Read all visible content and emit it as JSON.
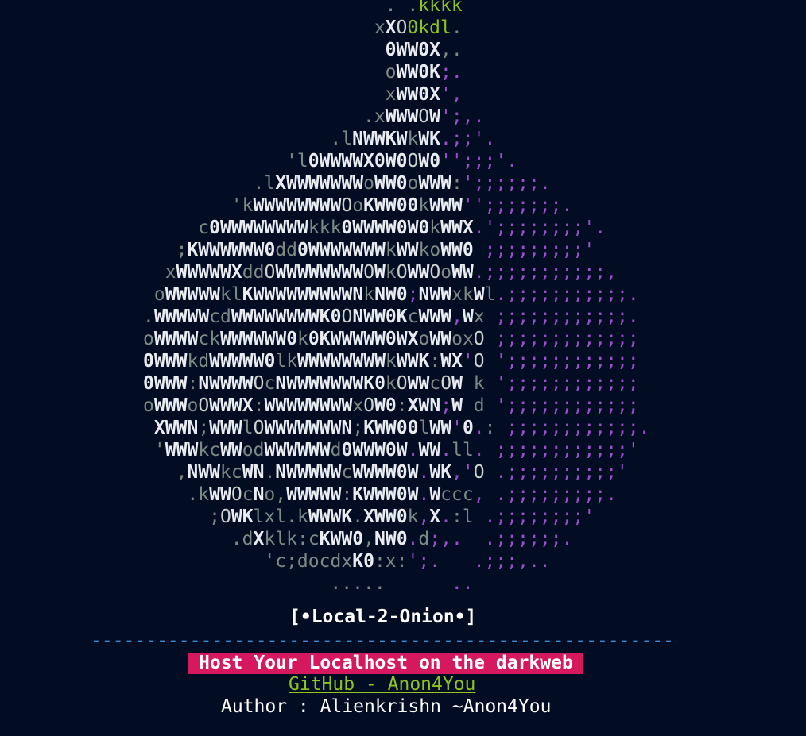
{
  "theme": {
    "background": "#020d24",
    "accent_green": "#8fc31f",
    "accent_purple": "#9b4fcf",
    "tagline_bg": "#d6195e",
    "divider_color": "#3c8fd6"
  },
  "ascii_art": [
    "                                   . .kkkk",
    "                                  xXO0kdl.",
    "                                   0WW0X,.",
    "                                   oWW0K;.",
    "                                   xWW0X',",
    "                                 .xWWWOW';,.",
    "                              .lNWWKWkWK.;;'.",
    "                          'l0WWWWX0W0OW0'';;;'.",
    "                       .lXWWWWWWWoWW0oWWW:';;;;;;.",
    "                     'kWWWWWWWWOoKWW00kWWW'';;;;;;;.",
    "                  c0WWWWWWWWkkk0WWWW0W0kWWX.';;;;;;;;'.",
    "                ;KWWWWWW0dd0WWWWWWWkWWkoWW0 ;;;;;;;;;'",
    "               xWWWWWXddOWWWWWWWWOWkOWWOoWW.;;;;;;;;;;;,",
    "              oWWWWWklKWWWWWWWWWNkNW0;NWWxkWl.;;;;;;;;;;;.",
    "             .WWWWWcdWWWWWWWWK0ONWW0KcWWW,Wx ;;;;;;;;;;;;.",
    "             oWWWWckWWWWWW0k0KWWWWW0WXoWWoxO ;;;;;;;;;;;;;",
    "             0WWWkdWWWWW0lkWWWWWWWWkWWK:WX'O ';;;;;;;;;;;;",
    "             0WWW:NWWWWOcNWWWWWWWK0kOWWcOW k ';;;;;;;;;;;;",
    "             oWWWoOWWWX:WWWWWWWWxOW0:XWN;W d ';;;;;;;;;;;;",
    "              XWWN;WWWlOWWWWWWWN;KWW00lWW'0.: ;;;;;;;;;;;;.",
    "              'WWWkcWWodWWWWWWd0WWW0W.WW.ll. ;;;;;;;;;;;;'",
    "                ,NWWkcWN.NWWWWWcWWWW0W.WK,'O .;;;;;;;;;;'",
    "                 .kWWOcNo,WWWWW:KWWW0W.Wccc, .;;;;;;;;;.",
    "                   ;OWKlxl.kWWWK.XWW0k,X.:l .;;;;;;;;'",
    "                     .dXklk:cKWW0,NW0.d;,.  .;;;;;;.",
    "                        'c;docdxK0:x:';.   .;;;,..",
    "                              .....      .."
  ],
  "brand": {
    "title": "[•Local-2-Onion•]",
    "divider": "-----------------------------------------------------------------",
    "tagline": "Host Your Localhost on the darkweb",
    "github_link": "GitHub - Anon4You",
    "author": "Author : Alienkrishn ~Anon4You"
  }
}
